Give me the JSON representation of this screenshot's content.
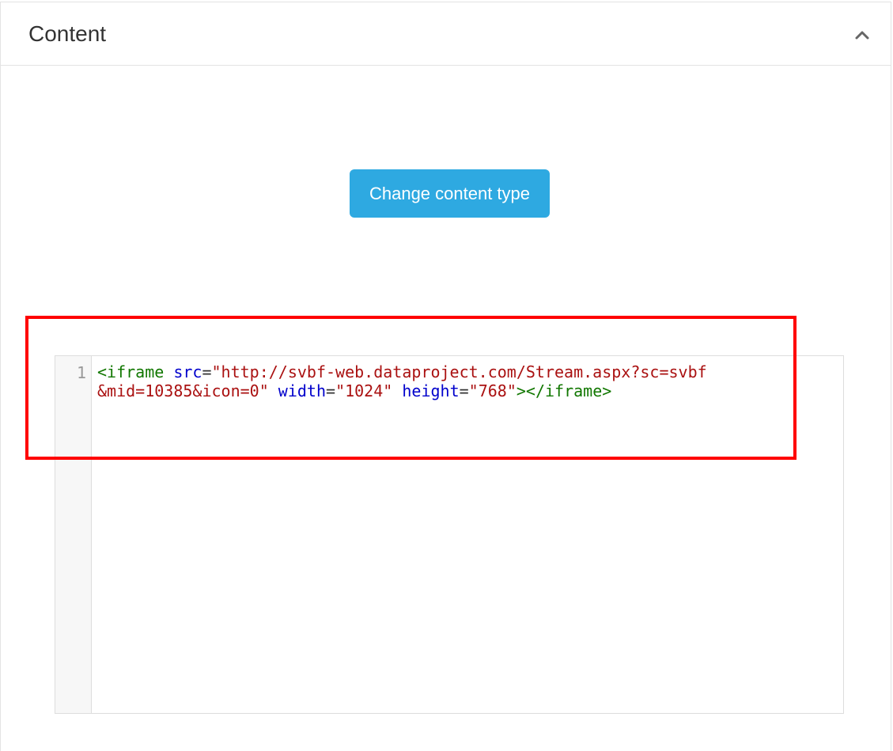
{
  "panel": {
    "title": "Content",
    "collapse_icon": "chevron-up-icon"
  },
  "toolbar": {
    "change_content_type_label": "Change content type",
    "button_color": "#2ea9e1"
  },
  "editor": {
    "line_number": "1",
    "tokens": {
      "t1": "<iframe",
      "t2": " ",
      "t3": "src",
      "t4": "=",
      "t5": "\"http://svbf-web.dataproject.com/Stream.aspx?sc=svbf&mid=10385&icon=0\"",
      "t6": " ",
      "t7": "width",
      "t8": "=",
      "t9": "\"1024\"",
      "t10": " ",
      "t11": "height",
      "t12": "=",
      "t13": "\"768\"",
      "t14": "></iframe>"
    },
    "colors": {
      "tag": "#117700",
      "attribute": "#0000cc",
      "string": "#aa1111"
    }
  },
  "annotation": {
    "highlight_color": "#ff0000"
  }
}
